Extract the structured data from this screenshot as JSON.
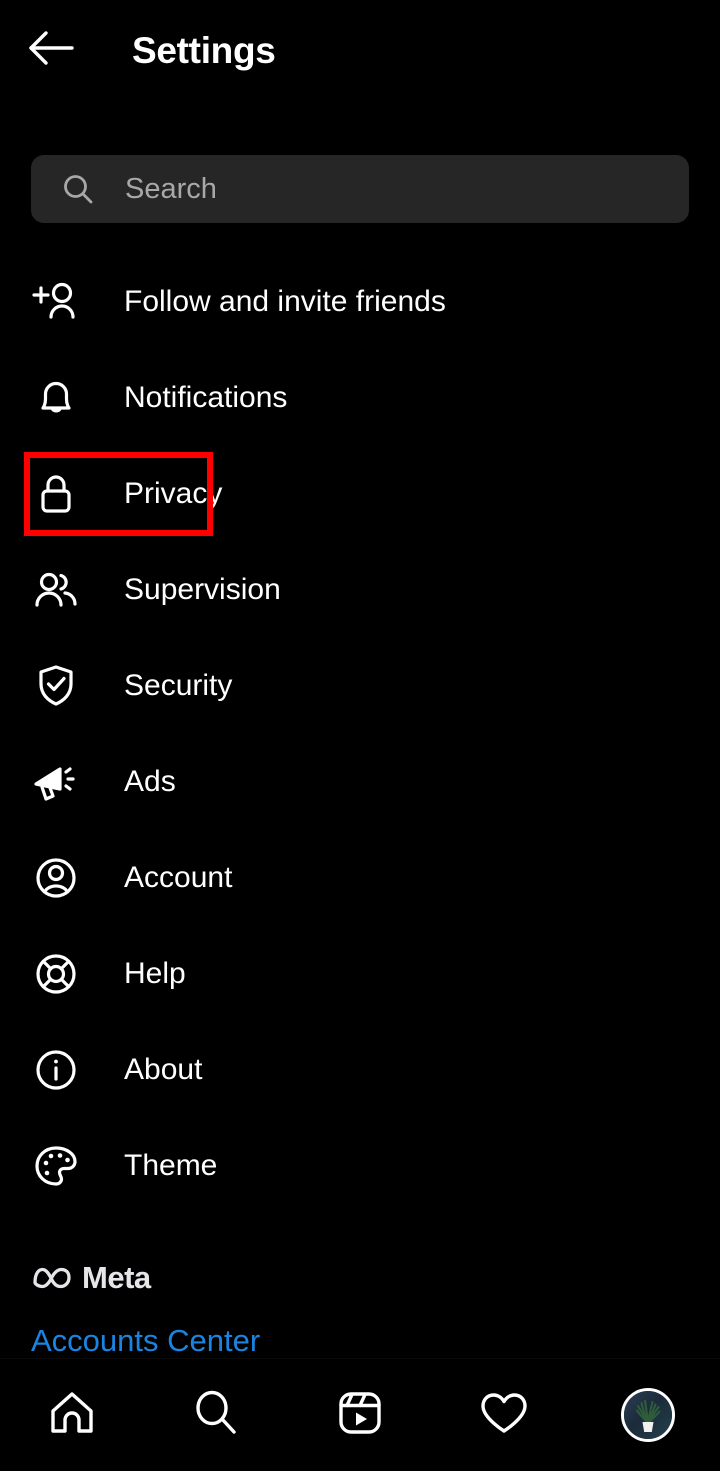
{
  "header": {
    "title": "Settings",
    "back_icon": "arrow-left-icon"
  },
  "search": {
    "placeholder": "Search",
    "icon": "search-icon",
    "value": ""
  },
  "menu": {
    "items": [
      {
        "label": "Follow and invite friends",
        "icon": "person-add-icon",
        "highlighted": false
      },
      {
        "label": "Notifications",
        "icon": "bell-icon",
        "highlighted": false
      },
      {
        "label": "Privacy",
        "icon": "lock-icon",
        "highlighted": true
      },
      {
        "label": "Supervision",
        "icon": "people-group-icon",
        "highlighted": false
      },
      {
        "label": "Security",
        "icon": "shield-check-icon",
        "highlighted": false
      },
      {
        "label": "Ads",
        "icon": "megaphone-icon",
        "highlighted": false
      },
      {
        "label": "Account",
        "icon": "person-circle-icon",
        "highlighted": false
      },
      {
        "label": "Help",
        "icon": "life-preserver-icon",
        "highlighted": false
      },
      {
        "label": "About",
        "icon": "info-circle-icon",
        "highlighted": false
      },
      {
        "label": "Theme",
        "icon": "palette-icon",
        "highlighted": false
      }
    ]
  },
  "footer": {
    "meta_label": "Meta",
    "meta_logo_icon": "meta-infinity-icon",
    "accounts_center_label": "Accounts Center"
  },
  "bottom_nav": {
    "items": [
      {
        "name": "home",
        "icon": "home-icon"
      },
      {
        "name": "search",
        "icon": "search-icon"
      },
      {
        "name": "reels",
        "icon": "reels-icon"
      },
      {
        "name": "activity",
        "icon": "heart-icon"
      },
      {
        "name": "profile",
        "icon": "avatar-icon"
      }
    ]
  },
  "colors": {
    "background": "#000000",
    "text_primary": "#ffffff",
    "text_muted": "#a8a8a8",
    "search_field": "#262626",
    "link_blue": "#1a84e0",
    "highlight_red": "#ff0000"
  }
}
